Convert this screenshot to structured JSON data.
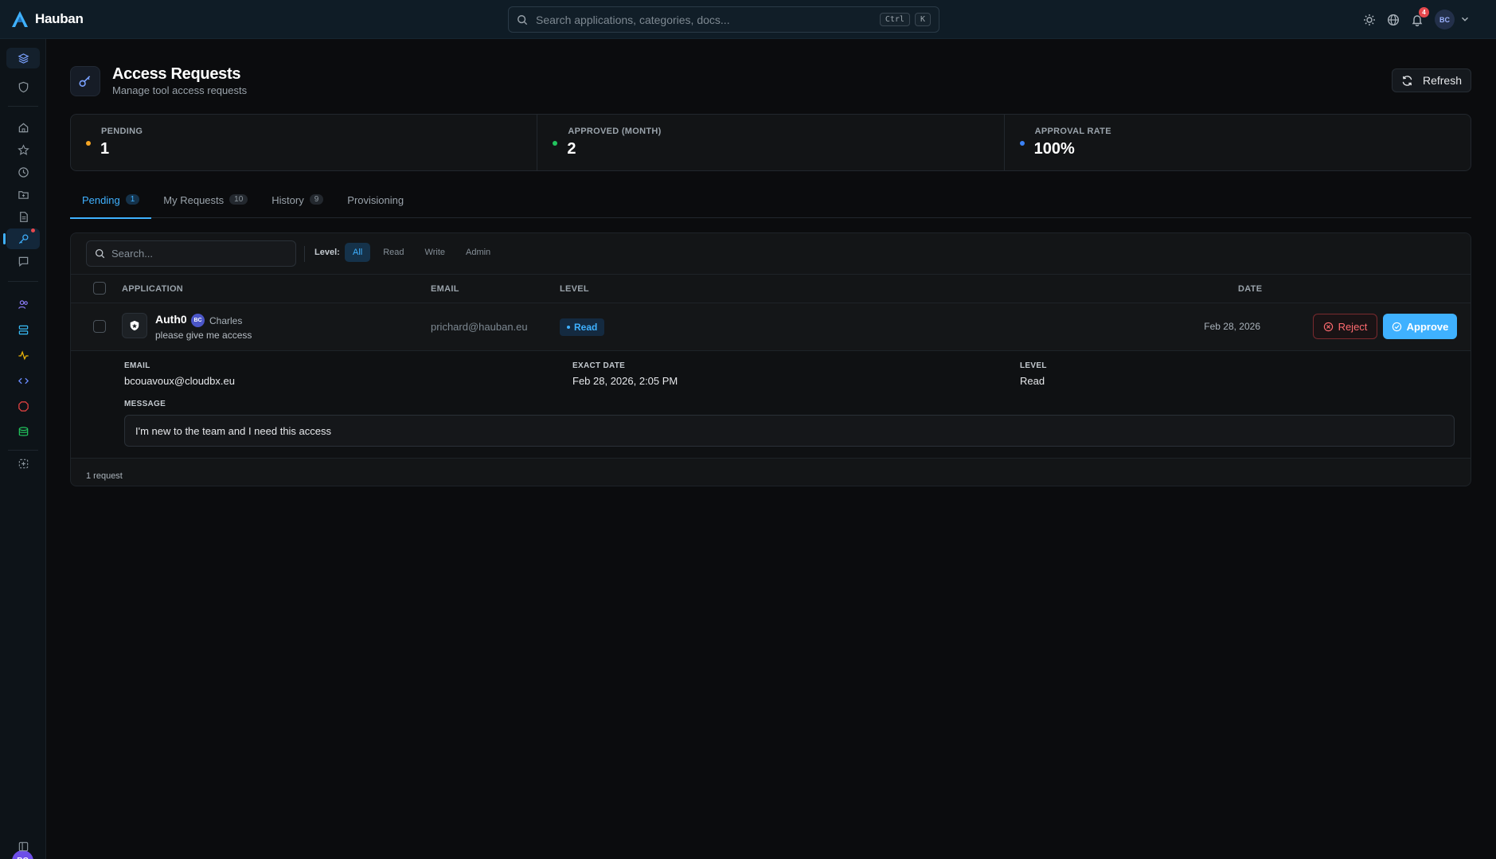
{
  "brand": {
    "name": "Hauban"
  },
  "global_search": {
    "placeholder": "Search applications, categories, docs...",
    "kbd1": "Ctrl",
    "kbd2": "K"
  },
  "topbar": {
    "notification_count": "4",
    "user_initials": "BC"
  },
  "sidebar": {
    "items": [
      "layers-icon",
      "shield-icon",
      "home-icon",
      "star-icon",
      "clock-icon",
      "folder-icon",
      "file-icon",
      "key-icon",
      "chat-icon",
      "users-icon",
      "database-icon",
      "activity-icon",
      "code-icon",
      "security-icon",
      "storage-icon",
      "add-icon",
      "panel-icon"
    ],
    "active": "key-icon",
    "user_initials": "BC"
  },
  "page": {
    "title": "Access Requests",
    "subtitle": "Manage tool access requests",
    "refresh_label": "Refresh"
  },
  "stats": [
    {
      "label": "PENDING",
      "value": "1",
      "color": "#f5a524"
    },
    {
      "label": "APPROVED (MONTH)",
      "value": "2",
      "color": "#22c55e"
    },
    {
      "label": "APPROVAL RATE",
      "value": "100%",
      "color": "#3b82f6"
    }
  ],
  "tabs": [
    {
      "label": "Pending",
      "count": "1",
      "active": true
    },
    {
      "label": "My Requests",
      "count": "10"
    },
    {
      "label": "History",
      "count": "9"
    },
    {
      "label": "Provisioning",
      "count": ""
    }
  ],
  "filters": {
    "search_placeholder": "Search...",
    "level_label": "Level:",
    "levels": [
      "All",
      "Read",
      "Write",
      "Admin"
    ],
    "active_level": "All"
  },
  "table": {
    "columns": {
      "application": "APPLICATION",
      "email": "EMAIL",
      "level": "LEVEL",
      "date": "DATE"
    },
    "rows": [
      {
        "app": "Auth0",
        "user_initials": "BC",
        "user_name": "Charles",
        "message": "please give me access",
        "email": "prichard@hauban.eu",
        "level": "Read",
        "date": "Feb 28, 2026",
        "reject_label": "Reject",
        "approve_label": "Approve",
        "details": {
          "email_label": "EMAIL",
          "email": "bcouavoux@cloudbx.eu",
          "exact_date_label": "EXACT DATE",
          "exact_date": "Feb 28, 2026, 2:05 PM",
          "level_label": "LEVEL",
          "level": "Read",
          "message_label": "MESSAGE",
          "message": "I'm new to the team and I need this access"
        }
      }
    ],
    "footer": "1 request"
  }
}
